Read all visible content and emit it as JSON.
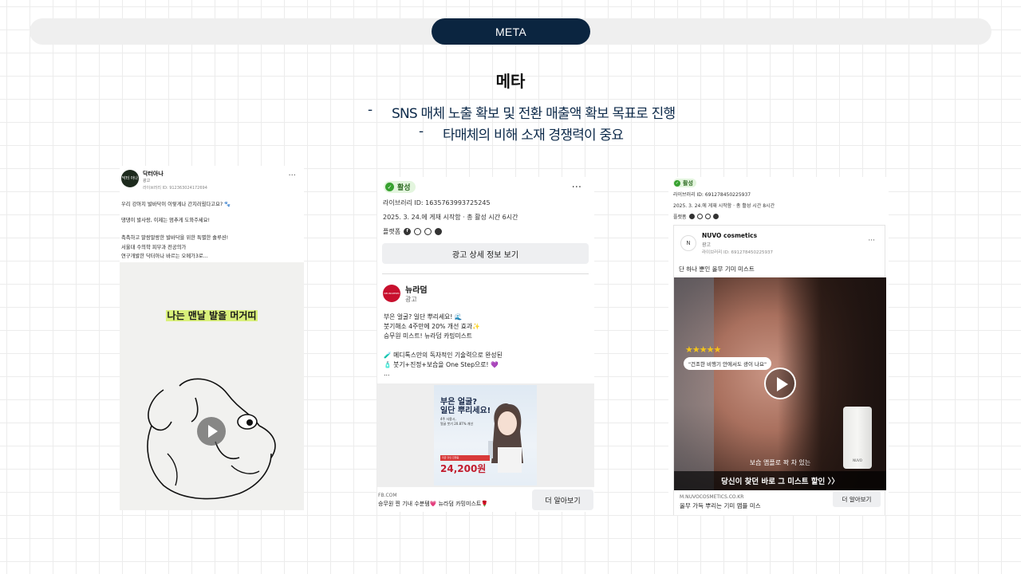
{
  "header": {
    "pill_label": "META",
    "title": "메타",
    "bullets": [
      "SNS 매체 노출 확보 및 전환 매출액 확보 목표로 진행",
      "타매체의 비해 소재 경쟁력이 중요"
    ],
    "dash": "-"
  },
  "card1": {
    "avatar_text": "닥터 아나",
    "name": "닥터아나",
    "ad_label": "광고",
    "library_id": "라이브러리 ID: 912363024172694",
    "menu": "···",
    "lines": [
      "우리 강아지 발바닥이 이렇게나 간지러웠다고요? 🐾",
      "",
      "댕댕이 발사랑, 이제는 멈추게 도와주세요!",
      "",
      "촉촉하고 말랑말랑한 발바닥을 위한 특별한 솔루션!",
      "서울대 수의학 피부과 전공의가",
      "연구개발한 닥터아나 바르는 오메가3로..."
    ],
    "video_caption": "나는 맨날 발을 머거띠"
  },
  "card2": {
    "status": "활성",
    "menu": "···",
    "library_id": "라이브러리 ID: 1635763993725245",
    "start_info": "2025. 3. 24.에 게재 시작함 · 총 활성 시간 6시간",
    "platform_label": "플랫폼",
    "details_button": "광고 상세 정보 보기",
    "advertiser": "뉴라덤",
    "ad_label": "광고",
    "logo_text": "NEURADERM",
    "lines": [
      "부은 얼굴? 일단 뿌리세요! 🌊",
      "붓기해소 4주만에 20% 개선 효과✨",
      "승무원 미스트! 뉴라덤 카밍미스트",
      "",
      "🧪 메디톡스만의 독자적인 기술력으로 완성된",
      "🧴 붓기+진정+보습을 One Step으로! 💜",
      "..."
    ],
    "poster_headline_1": "부은 얼굴?",
    "poster_headline_2": "일단 뿌리세요!",
    "poster_sub_1": "4주 사용시,",
    "poster_sub_2": "얼굴 붓기 20.87% 개선",
    "poster_banner": "지금 할인 진행중",
    "price": "24,200원",
    "domain": "FB.COM",
    "footer_text": "승무원 찐 기내 수분템💗 뉴라덤 카밍미스트🌹",
    "more_button": "더 알아보기"
  },
  "card3": {
    "status": "활성",
    "library_id": "라이브러리 ID: 691278450225937",
    "start_info": "2025. 3. 24.에 게재 시작함 · 총 활성 시간 8시간",
    "platform_label": "플랫폼",
    "logo_text": "N",
    "advertiser": "NUVO cosmetics",
    "ad_label": "광고",
    "inner_library_id": "라이브러리 ID: 691278450225937",
    "menu": "···",
    "body_text": "단 하나 뿐인 올무 기미 미스트",
    "stars": "★★★★★",
    "bubble": "\"건조한 비행기 안에서도 광이 나요\"",
    "bottle_label": "NUVO",
    "subtitle_1": "보습 앰플로 꽉 차 있는",
    "subtitle_2": "당신이 찾던 바로 그 미스트 할인 〉〉",
    "domain": "M.NUVOCOSMETICS.CO.KR",
    "footer_text": "올무 가득 뿌리는 기미 앰플 미스",
    "more_button": "더 알아보기"
  },
  "icons": [
    "facebook-icon",
    "instagram-icon",
    "audience-network-icon",
    "messenger-icon",
    "play-icon",
    "more-options-icon"
  ]
}
